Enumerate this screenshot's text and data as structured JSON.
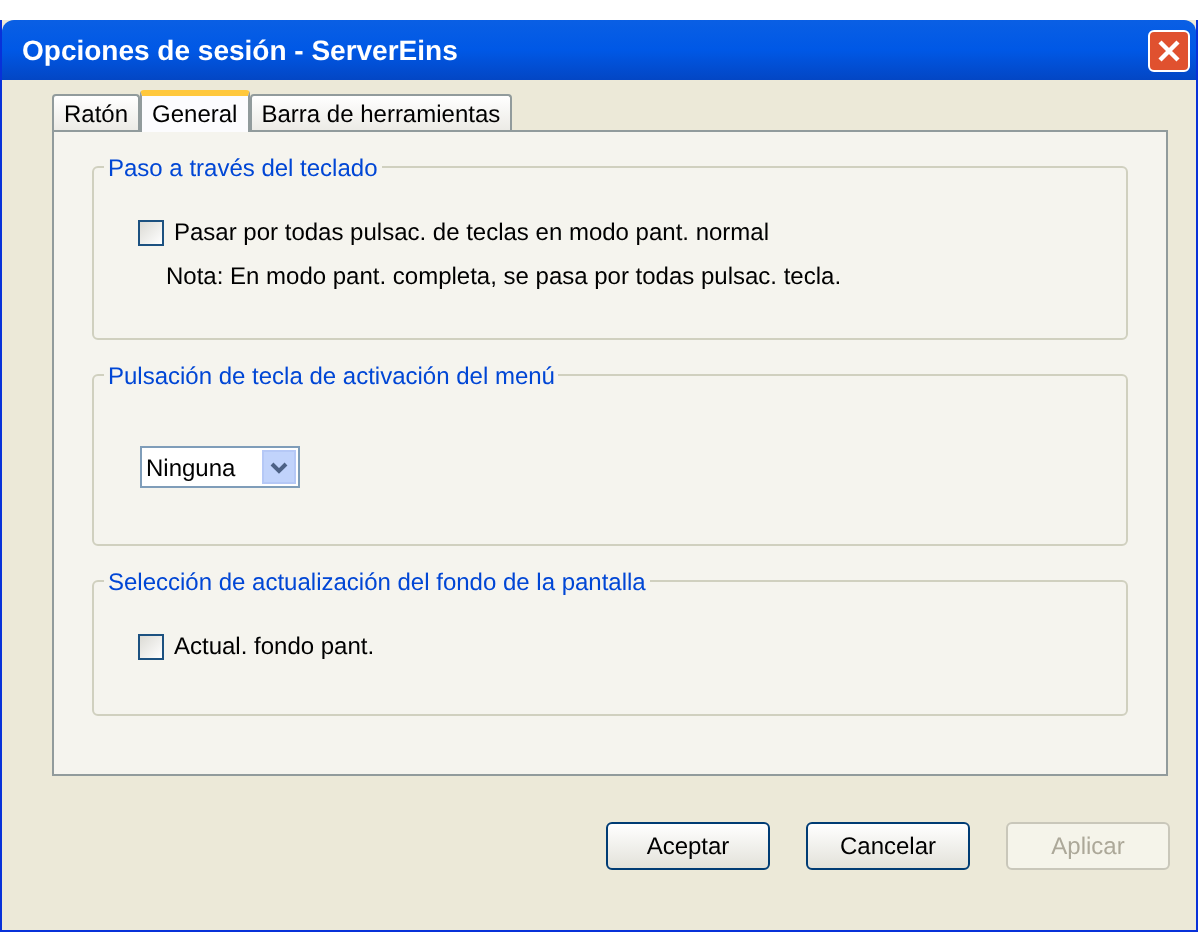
{
  "window": {
    "title": "Opciones de sesión - ServerEins"
  },
  "tabs": [
    {
      "label": "Ratón",
      "selected": false
    },
    {
      "label": "General",
      "selected": true
    },
    {
      "label": "Barra de herramientas",
      "selected": false
    }
  ],
  "groups": [
    {
      "title": "Paso a través del teclado",
      "items": [
        {
          "kind": "checkbox",
          "label": "Pasar por todas pulsac. de teclas en modo pant. normal",
          "checked": false
        },
        {
          "kind": "note",
          "text": "Nota: En modo pant. completa, se pasa por todas pulsac. tecla."
        }
      ]
    },
    {
      "title": "Pulsación de tecla de activación del menú",
      "items": [
        {
          "kind": "dropdown",
          "value": "Ninguna"
        }
      ]
    },
    {
      "title": "Selección de actualización del fondo de la pantalla",
      "items": [
        {
          "kind": "checkbox",
          "label": "Actual. fondo pant.",
          "checked": false
        }
      ]
    }
  ],
  "buttons": [
    {
      "label": "Aceptar",
      "disabled": false
    },
    {
      "label": "Cancelar",
      "disabled": false
    },
    {
      "label": "Aplicar",
      "disabled": true
    }
  ]
}
